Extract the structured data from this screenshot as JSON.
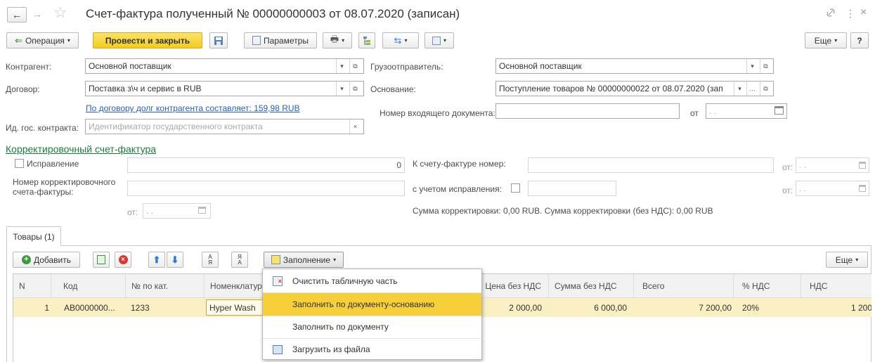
{
  "window": {
    "title": "Счет-фактура полученный № 00000000003 от 08.07.2020 (записан)",
    "more_glyph": "⋮",
    "close_glyph": "×"
  },
  "toolbar": {
    "operation": "Операция",
    "post_close": "Провести и закрыть",
    "params": "Параметры",
    "more": "Еще",
    "help": "?"
  },
  "form": {
    "counterparty_label": "Контрагент:",
    "counterparty_value": "Основной поставщик",
    "contract_label": "Договор:",
    "contract_value": "Поставка з\\ч и сервис в RUB",
    "debt_link": "По договору долг контрагента составляет: 159,98 RUB",
    "gov_label": "Ид. гос. контракта:",
    "gov_placeholder": "Идентификатор государственного контракта",
    "shipper_label": "Грузоотправитель:",
    "shipper_value": "Основной поставщик",
    "basis_label": "Основание:",
    "basis_value": "Поступление товаров № 00000000022 от 08.07.2020 (зап",
    "incoming_label": "Номер входящего документа:",
    "from_label": "от",
    "date_placeholder": " .  ."
  },
  "correction": {
    "link": "Корректировочный счет-фактура",
    "fix_label": "Исправление",
    "zero": "0",
    "corr_number_label": "Номер корректировочного счета-фактуры:",
    "from_label": "от:",
    "to_invoice_label": "К счету-фактуре номер:",
    "with_fix_label": "с учетом исправления:",
    "sum_text": "Сумма корректировки: 0,00 RUB. Сумма корректировки (без НДС): 0,00 RUB"
  },
  "tabs": {
    "goods": "Товары (1)"
  },
  "table_toolbar": {
    "add": "Добавить",
    "fill": "Заполнение",
    "more": "Еще"
  },
  "table": {
    "headers": [
      "N",
      "Код",
      "№ по кат.",
      "Номенклатур",
      "Цена без НДС",
      "Сумма без НДС",
      "Всего",
      "% НДС",
      "НДС"
    ],
    "row": {
      "n": "1",
      "code": "АВ0000000...",
      "cat": "1233",
      "nom": "Hyper Wash",
      "price": "2 000,00",
      "sum": "6 000,00",
      "total": "7 200,00",
      "vat_rate": "20%",
      "vat": "1 200"
    }
  },
  "dropdown": {
    "items": [
      "Очистить табличную часть",
      "Заполнить по документу-основанию",
      "Заполнить по документу",
      "Загрузить из файла"
    ]
  },
  "colors": {
    "accent_yellow": "#f5d32e",
    "link_green": "#1a7b3c",
    "link_blue": "#2b5fa8",
    "row_highlight": "#fbf0c3",
    "menu_highlight": "#f7cf3a"
  }
}
